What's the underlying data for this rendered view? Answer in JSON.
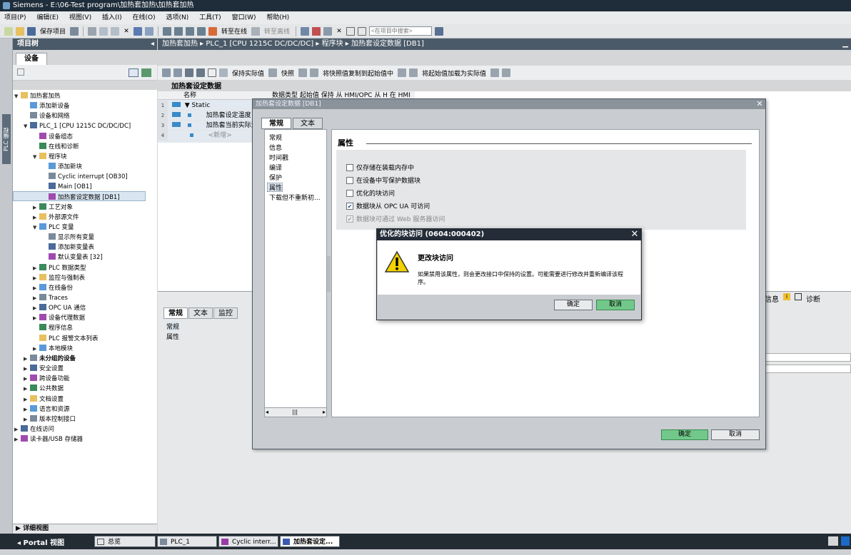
{
  "window": {
    "title": "Siemens  -  E:\\06-Test program\\加热套加热\\加热套加热"
  },
  "menu": [
    "项目(P)",
    "编辑(E)",
    "视图(V)",
    "插入(I)",
    "在线(O)",
    "选项(N)",
    "工具(T)",
    "窗口(W)",
    "帮助(H)"
  ],
  "toolbar": {
    "save": "保存项目",
    "go_online": "转至在线",
    "go_offline": "转至离线",
    "search_placeholder": "<在项目中搜索>"
  },
  "project_tree": {
    "title": "项目树",
    "devices_tab": "设备",
    "side_tab": "PLC 编程",
    "items": [
      {
        "label": "加热套加热",
        "level": 0,
        "exp": "▼"
      },
      {
        "label": "添加新设备",
        "level": 1,
        "exp": ""
      },
      {
        "label": "设备和网络",
        "level": 1,
        "exp": ""
      },
      {
        "label": "PLC_1 [CPU 1215C DC/DC/DC]",
        "level": 1,
        "exp": "▼"
      },
      {
        "label": "设备组态",
        "level": 2,
        "exp": ""
      },
      {
        "label": "在线和诊断",
        "level": 2,
        "exp": ""
      },
      {
        "label": "程序块",
        "level": 2,
        "exp": "▼"
      },
      {
        "label": "添加新块",
        "level": 3,
        "exp": ""
      },
      {
        "label": "Cyclic interrupt [OB30]",
        "level": 3,
        "exp": ""
      },
      {
        "label": "Main [OB1]",
        "level": 3,
        "exp": ""
      },
      {
        "label": "加热套设定数据 [DB1]",
        "level": 3,
        "exp": ""
      },
      {
        "label": "工艺对象",
        "level": 2,
        "exp": "▶"
      },
      {
        "label": "外部源文件",
        "level": 2,
        "exp": "▶"
      },
      {
        "label": "PLC 变量",
        "level": 2,
        "exp": "▼"
      },
      {
        "label": "显示所有变量",
        "level": 3,
        "exp": ""
      },
      {
        "label": "添加新变量表",
        "level": 3,
        "exp": ""
      },
      {
        "label": "默认变量表 [32]",
        "level": 3,
        "exp": ""
      },
      {
        "label": "PLC 数据类型",
        "level": 2,
        "exp": "▶"
      },
      {
        "label": "监控与强制表",
        "level": 2,
        "exp": "▶"
      },
      {
        "label": "在线备份",
        "level": 2,
        "exp": "▶"
      },
      {
        "label": "Traces",
        "level": 2,
        "exp": "▶"
      },
      {
        "label": "OPC UA 通信",
        "level": 2,
        "exp": "▶"
      },
      {
        "label": "设备代理数据",
        "level": 2,
        "exp": "▶"
      },
      {
        "label": "程序信息",
        "level": 2,
        "exp": ""
      },
      {
        "label": "PLC 报警文本列表",
        "level": 2,
        "exp": ""
      },
      {
        "label": "本地模块",
        "level": 2,
        "exp": "▶"
      },
      {
        "label": "未分组的设备",
        "level": 1,
        "exp": "▶"
      },
      {
        "label": "安全设置",
        "level": 1,
        "exp": "▶"
      },
      {
        "label": "跨设备功能",
        "level": 1,
        "exp": "▶"
      },
      {
        "label": "公共数据",
        "level": 1,
        "exp": "▶"
      },
      {
        "label": "文档设置",
        "level": 1,
        "exp": "▶"
      },
      {
        "label": "语言和资源",
        "level": 1,
        "exp": "▶"
      },
      {
        "label": "版本控制接口",
        "level": 1,
        "exp": "▶"
      },
      {
        "label": "在线访问",
        "level": 0,
        "exp": "▶"
      },
      {
        "label": "读卡器/USB 存储器",
        "level": 0,
        "exp": "▶"
      }
    ],
    "detail_view": "详细视图"
  },
  "editor": {
    "breadcrumb": "加热套加热 ▸ PLC_1 [CPU 1215C DC/DC/DC] ▸ 程序块 ▸ 加热套设定数据 [DB1]",
    "toolbar": {
      "keep_actual": "保持实际值",
      "snapshot": "快照",
      "copy_snapshot": "将快照值复制到起始值中",
      "load_start": "将起始值加载为实际值"
    },
    "db_title": "加热套设定数据",
    "col_name": "名称",
    "col_headers_partial": "数据类型       起始值       保持       从 HMI/OPC   从 H   在 HMI   设定值   注释",
    "rows": [
      {
        "num": "1",
        "name": "▼ Static"
      },
      {
        "num": "2",
        "name": "加热套设定温度"
      },
      {
        "num": "3",
        "name": "加热套当前实际温"
      },
      {
        "num": "4",
        "name": "<新增>"
      }
    ]
  },
  "lower_panel": {
    "tabs": [
      "常规",
      "文本",
      "监控"
    ],
    "nav": [
      "常规",
      "属性"
    ],
    "info_tabs": [
      "信息",
      "诊断"
    ]
  },
  "props_dialog": {
    "title": "加热套设定数据 [DB1]",
    "tabs": [
      "常规",
      "文本"
    ],
    "nav": [
      "常规",
      "信息",
      "时间戳",
      "编译",
      "保护",
      "属性",
      "下载但不重新初..."
    ],
    "section": "属性",
    "options": [
      {
        "label": "仅存储在装载内存中",
        "checked": false,
        "disabled": false
      },
      {
        "label": "在设备中写保护数据块",
        "checked": false,
        "disabled": false
      },
      {
        "label": "优化的块访问",
        "checked": false,
        "disabled": false
      },
      {
        "label": "数据块从 OPC UA 可访问",
        "checked": true,
        "disabled": false
      },
      {
        "label": "数据块可通过 Web 服务器访问",
        "checked": true,
        "disabled": true
      }
    ],
    "ok": "确定",
    "cancel": "取消"
  },
  "alert": {
    "title": "优化的块访问 (0604:000402)",
    "heading": "更改块访问",
    "message": "如果禁用该属性，则会更改接口中保持的设置。可能需要进行修改并重新编译该程序。",
    "ok": "确定",
    "cancel": "取消"
  },
  "taskbar": {
    "portal": "Portal 视图",
    "items": [
      "总览",
      "PLC_1",
      "Cyclic interr...",
      "加热套设定..."
    ]
  }
}
